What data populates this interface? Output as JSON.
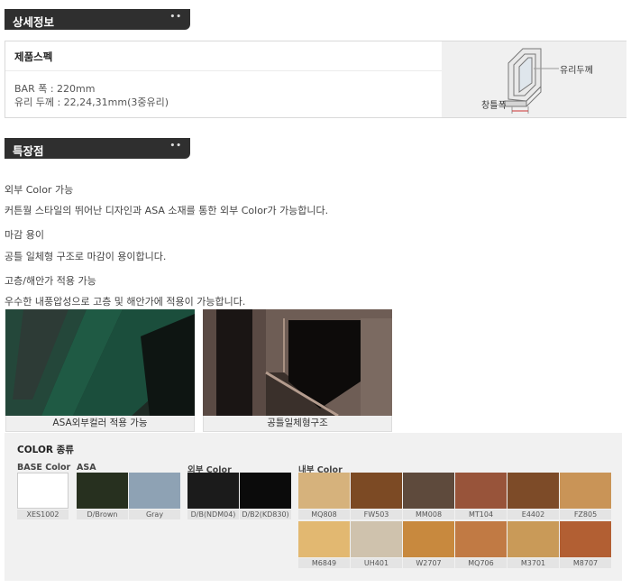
{
  "sections": {
    "detail_title": "상세정보",
    "feature_title": "특장점"
  },
  "spec": {
    "title": "제품스펙",
    "lines": [
      "BAR 폭 : 220mm",
      "유리 두께 : 22,24,31mm(3중유리)"
    ],
    "diagram_labels": [
      "유리두께",
      "창틀폭"
    ]
  },
  "features": [
    "외부 Color 가능",
    "커튼월 스타일의 뛰어난 디자인과 ASA 소재를 통한 외부 Color가 가능합니다.",
    "마감 용이",
    "공틀 일체형 구조로 마감이 용이합니다.",
    "고층/해안가 적용 가능",
    "우수한 내풍압성으로 고층 및 해안가에 적용이 가능합니다."
  ],
  "photos": [
    {
      "caption": "ASA외부컬러 적용 가능",
      "color": "#1d5240"
    },
    {
      "caption": "공틀일체형구조",
      "color": "#6b5a52"
    }
  ],
  "color_types": {
    "title": "COLOR 종류",
    "groups": [
      {
        "label": "BASE Color",
        "swatches": [
          {
            "name": "XES1002",
            "color": "#ffffff"
          }
        ]
      },
      {
        "label": "ASA",
        "swatches": [
          {
            "name": "D/Brown",
            "color": "#27301f"
          },
          {
            "name": "Gray",
            "color": "#8ea2b4"
          }
        ]
      },
      {
        "label": "외부 Color",
        "swatches": [
          {
            "name": "D/B(NDM04)",
            "color": "#1b1b1b"
          },
          {
            "name": "D/B2(KD830)",
            "color": "#0b0b0b"
          }
        ]
      },
      {
        "label": "내부 Color",
        "swatches": [
          {
            "name": "MQ808",
            "color": "#d6b27c"
          },
          {
            "name": "FW503",
            "color": "#7c4a24"
          },
          {
            "name": "MM008",
            "color": "#5e4a3c"
          },
          {
            "name": "MT104",
            "color": "#98543a"
          },
          {
            "name": "E4402",
            "color": "#7d4b28"
          },
          {
            "name": "FZ805",
            "color": "#c99457"
          },
          {
            "name": "M6849",
            "color": "#e2b871"
          },
          {
            "name": "UH401",
            "color": "#cfc2ad"
          },
          {
            "name": "W2707",
            "color": "#c8893e"
          },
          {
            "name": "MQ706",
            "color": "#c17a44"
          },
          {
            "name": "M3701",
            "color": "#c99a58"
          },
          {
            "name": "M8707",
            "color": "#b25f33"
          }
        ]
      }
    ]
  }
}
